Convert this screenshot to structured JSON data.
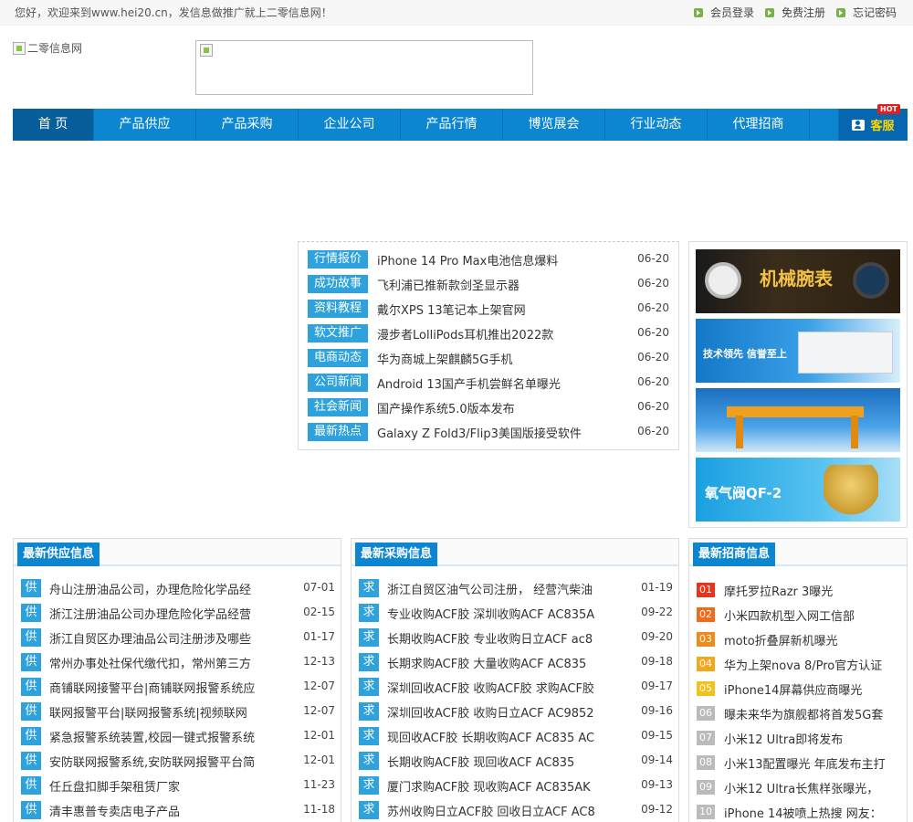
{
  "topbar": {
    "welcome": "您好，欢迎来到www.hei20.cn，发信息做推广就上二零信息网！",
    "links": [
      "会员登录",
      "免费注册",
      "忘记密码"
    ]
  },
  "logo": {
    "alt": "二零信息网"
  },
  "nav": {
    "items": [
      "首 页",
      "产品供应",
      "产品采购",
      "企业公司",
      "产品行情",
      "博览展会",
      "行业动态",
      "代理招商"
    ],
    "service_label": "客服",
    "hot_badge": "HOT"
  },
  "news": [
    {
      "tag": "行情报价",
      "title": "iPhone 14 Pro Max电池信息爆料",
      "date": "06-20"
    },
    {
      "tag": "成功故事",
      "title": "飞利浦已推新款剑圣显示器",
      "date": "06-20"
    },
    {
      "tag": "资料教程",
      "title": "戴尔XPS 13笔记本上架官网",
      "date": "06-20"
    },
    {
      "tag": "软文推广",
      "title": "漫步者LolliPods耳机推出2022款",
      "date": "06-20"
    },
    {
      "tag": "电商动态",
      "title": "华为商城上架麒麟5G手机",
      "date": "06-20"
    },
    {
      "tag": "公司新闻",
      "title": "Android 13国产手机尝鲜名单曝光",
      "date": "06-20"
    },
    {
      "tag": "社会新闻",
      "title": "国产操作系统5.0版本发布",
      "date": "06-20"
    },
    {
      "tag": "最新热点",
      "title": "Galaxy Z Fold3/Flip3美国版接受软件",
      "date": "06-20"
    }
  ],
  "ads": {
    "ad1_text": "机械腕表",
    "ad2_text": "技术领先  信誉至上",
    "ad4_text": "氧气阀QF-2"
  },
  "supply": {
    "title": "最新供应信息",
    "badge": "供",
    "rows": [
      {
        "text": "舟山注册油品公司，办理危险化学品经",
        "date": "07-01"
      },
      {
        "text": "浙江注册油品公司办理危险化学品经营",
        "date": "02-15"
      },
      {
        "text": "浙江自贸区办理油品公司注册涉及哪些",
        "date": "01-17"
      },
      {
        "text": "常州办事处社保代缴代扣，常州第三方",
        "date": "12-13"
      },
      {
        "text": "商铺联网接警平台|商铺联网报警系统应",
        "date": "12-07"
      },
      {
        "text": "联网报警平台|联网报警系统|视频联网",
        "date": "12-07"
      },
      {
        "text": "紧急报警系统装置,校园一键式报警系统",
        "date": "12-01"
      },
      {
        "text": "安防联网报警系统,安防联网报警平台简",
        "date": "12-01"
      },
      {
        "text": "任丘盘扣脚手架租赁厂家",
        "date": "11-23"
      },
      {
        "text": "清丰惠普专卖店电子产品",
        "date": "11-18"
      }
    ]
  },
  "purchase": {
    "title": "最新采购信息",
    "badge": "求",
    "rows": [
      {
        "text": "浙江自贸区油气公司注册， 经营汽柴油",
        "date": "01-19"
      },
      {
        "text": "专业收购ACF胶 深圳收购ACF AC835A",
        "date": "09-22"
      },
      {
        "text": "长期收购ACF胶 专业收购日立ACF ac8",
        "date": "09-20"
      },
      {
        "text": "长期求购ACF胶 大量收购ACF AC835",
        "date": "09-18"
      },
      {
        "text": "深圳回收ACF胶 收购ACF胶 求购ACF胶",
        "date": "09-17"
      },
      {
        "text": "深圳回收ACF胶 收购日立ACF AC9852",
        "date": "09-16"
      },
      {
        "text": "现回收ACF胶 长期收购ACF AC835 AC",
        "date": "09-15"
      },
      {
        "text": "长期收购ACF胶 现回收ACF AC835",
        "date": "09-14"
      },
      {
        "text": "厦门求购ACF胶 现收购ACF AC835AK",
        "date": "09-13"
      },
      {
        "text": "苏州收购日立ACF胶 回收日立ACF AC8",
        "date": "09-12"
      }
    ]
  },
  "merchants": {
    "title": "最新招商信息",
    "rows": [
      {
        "num": "01",
        "color": "#e8341c",
        "text": "摩托罗拉Razr 3曝光"
      },
      {
        "num": "02",
        "color": "#f06a1c",
        "text": "小米四款机型入网工信部"
      },
      {
        "num": "03",
        "color": "#f08a1c",
        "text": "moto折叠屏新机曝光"
      },
      {
        "num": "04",
        "color": "#f0a81c",
        "text": "华为上架nova 8/Pro官方认证"
      },
      {
        "num": "05",
        "color": "#f0c21c",
        "text": "iPhone14屏幕供应商曝光"
      },
      {
        "num": "06",
        "color": "#bbbbbb",
        "text": "曝未来华为旗舰都将首发5G套"
      },
      {
        "num": "07",
        "color": "#bbbbbb",
        "text": "小米12 Ultra即将发布"
      },
      {
        "num": "08",
        "color": "#bbbbbb",
        "text": "小米13配置曝光 年底发布主打"
      },
      {
        "num": "09",
        "color": "#bbbbbb",
        "text": "小米12 Ultra长焦样张曝光，"
      },
      {
        "num": "10",
        "color": "#bbbbbb",
        "text": "iPhone 14被喷上热搜 网友："
      }
    ]
  }
}
